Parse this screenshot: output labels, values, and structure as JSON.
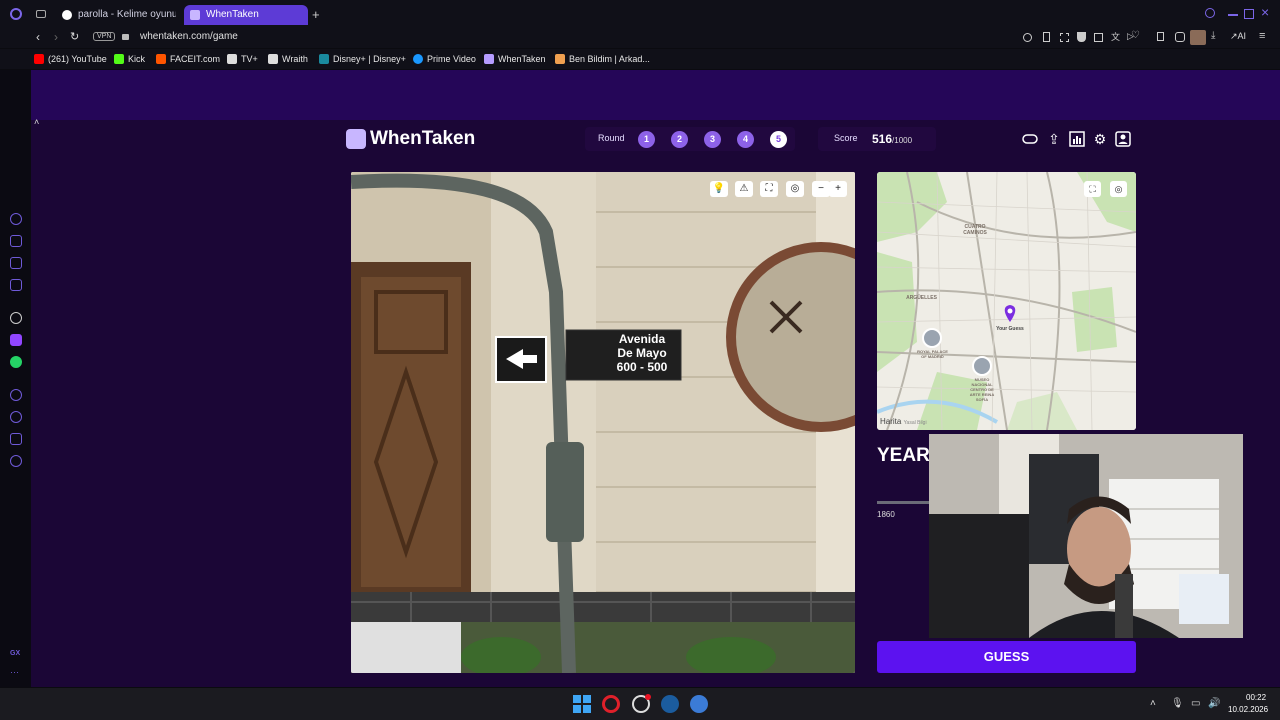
{
  "browser": {
    "tabs": [
      {
        "label": "parolla - Kelime oyunu. Gü",
        "active": false
      },
      {
        "label": "WhenTaken",
        "active": true
      }
    ],
    "address": "whentaken.com/game",
    "vpn_label": "VPN",
    "ai_label": "AI",
    "bookmarks": [
      {
        "label": "(261) YouTube",
        "color": "#ff0000"
      },
      {
        "label": "Kick",
        "color": "#53fc18"
      },
      {
        "label": "FACEIT.com",
        "color": "#ff5500"
      },
      {
        "label": "TV+",
        "color": "#dddddd"
      },
      {
        "label": "Wraith",
        "color": "#dddddd"
      },
      {
        "label": "Disney+ | Disney+",
        "color": "#1a8a9e"
      },
      {
        "label": "Prime Video",
        "color": "#1a98ff"
      },
      {
        "label": "WhenTaken",
        "color": "#b59cff"
      },
      {
        "label": "Ben Bildim | Arkad...",
        "color": "#f0a050"
      }
    ]
  },
  "game": {
    "logo": "WhenTaken",
    "round_label": "Round",
    "rounds": [
      "1",
      "2",
      "3",
      "4",
      "5"
    ],
    "current_round": 5,
    "score_label": "Score",
    "score_value": "516",
    "score_max": "/1000",
    "street_sign": {
      "line1": "Avenida",
      "line2": "De Mayo",
      "line3": "600 - 500"
    },
    "map_labels": {
      "cuatro": "CUATRO\nCAMINOS",
      "arguelles": "ARGÜELLES",
      "your_guess": "Your Guess",
      "palace": "ROYAL PALACE\nOF MADRID",
      "museum": "MUSEO\nNACIONAL\nCENTRO DE\nARTE REINA\nSOFÍA",
      "harita": "Harita",
      "yasal": "Yasal Bilgi"
    },
    "year_label": "YEAR",
    "year_min": "1860",
    "guess_button": "GUESS"
  },
  "taskbar": {
    "time": "00:22",
    "date": "10.02.2026"
  }
}
